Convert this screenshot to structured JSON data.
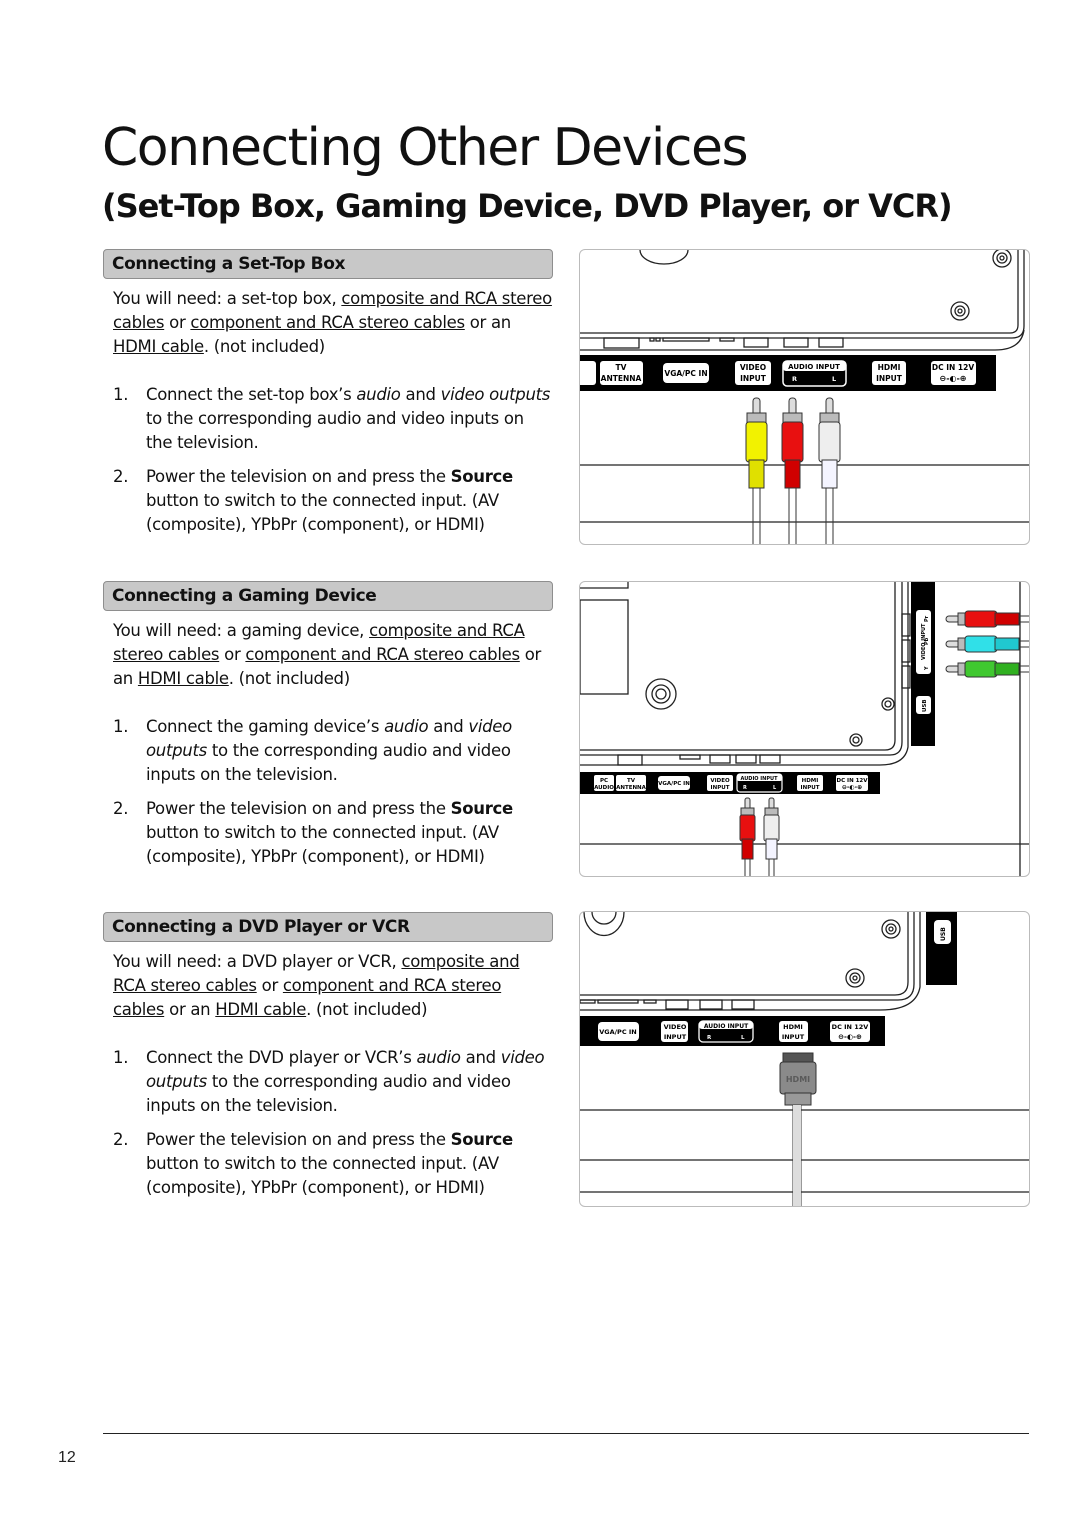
{
  "page": {
    "title": "Connecting Other Devices",
    "subtitle": "(Set-Top Box, Gaming Device, DVD Player, or VCR)",
    "page_number": "12"
  },
  "sections": [
    {
      "heading": "Connecting a Set-Top Box",
      "need_prefix": "You will need: a set-top box, ",
      "link1": "composite and RCA stereo cables",
      "or1": " or ",
      "link2": "component and RCA stereo cables",
      "or2": " or an ",
      "link3": "HDMI cable",
      "need_suffix": ". (not included)",
      "steps": [
        {
          "num": "1.",
          "pre": "Connect the set-top box’s ",
          "em1": "audio",
          "mid": " and ",
          "em2": "video outputs",
          "post": " to the corresponding audio and video inputs on the television."
        },
        {
          "num": "2.",
          "pre": "Power the television on and press the ",
          "strong": "Source",
          "post": " button to switch to the connected input. (AV (composite), YPbPr (component), or HDMI)"
        }
      ]
    },
    {
      "heading": "Connecting a Gaming Device",
      "need_prefix": "You will need: a gaming device, ",
      "link1": "composite and RCA stereo cables",
      "or1": " or ",
      "link2": "component and RCA stereo cables",
      "or2": " or an ",
      "link3": "HDMI cable",
      "need_suffix": ". (not included)",
      "steps": [
        {
          "num": "1.",
          "pre": "Connect the gaming device’s ",
          "em1": "audio",
          "mid": " and ",
          "em2": "video outputs",
          "post": " to the corresponding audio and video inputs on the television."
        },
        {
          "num": "2.",
          "pre": "Power the television on and press the ",
          "strong": "Source",
          "post": " button to switch to the connected input. (AV (composite), YPbPr (component), or HDMI)"
        }
      ]
    },
    {
      "heading": "Connecting a DVD Player or VCR",
      "need_prefix": "You will need: a DVD player or VCR, ",
      "link1": "composite and RCA stereo cables",
      "or1": " or ",
      "link2": "component and RCA stereo cables",
      "or2": " or an ",
      "link3": "HDMI cable",
      "need_suffix": ". (not included)",
      "steps": [
        {
          "num": "1.",
          "pre": "Connect the DVD player or VCR’s ",
          "em1": "audio",
          "mid": " and ",
          "em2": "video outputs",
          "post": " to the corresponding audio and video inputs on the television."
        },
        {
          "num": "2.",
          "pre": "Power the television on and press the ",
          "strong": "Source",
          "post": " button to switch to the connected input. (AV (composite), YPbPr (component), or HDMI)"
        }
      ]
    }
  ],
  "port_labels": {
    "pc_audio": [
      "PC",
      "AUDIO"
    ],
    "tv_antenna": [
      "TV",
      "ANTENNA"
    ],
    "vga": "VGA/PC IN",
    "video_input": [
      "VIDEO",
      "INPUT"
    ],
    "audio_input": "AUDIO INPUT",
    "audio_r": "R",
    "audio_l": "L",
    "hdmi_input": [
      "HDMI",
      "INPUT"
    ],
    "dc_in": "DC IN 12V",
    "dc_symbol": "⊖-◐-⊕",
    "side_video_input": "VIDEO INPUT",
    "side_pr": "Pr",
    "side_pb": "Pb",
    "side_y": "Y",
    "usb": "USB",
    "hdmi_plug": "HDMI"
  },
  "colors": {
    "heading_bg": "#c8c8c8",
    "cable_yellow": "#f2f200",
    "cable_red": "#e81010",
    "cable_white": "#e8e8e8",
    "cable_cyan": "#30e0e8",
    "cable_green": "#40c830"
  }
}
